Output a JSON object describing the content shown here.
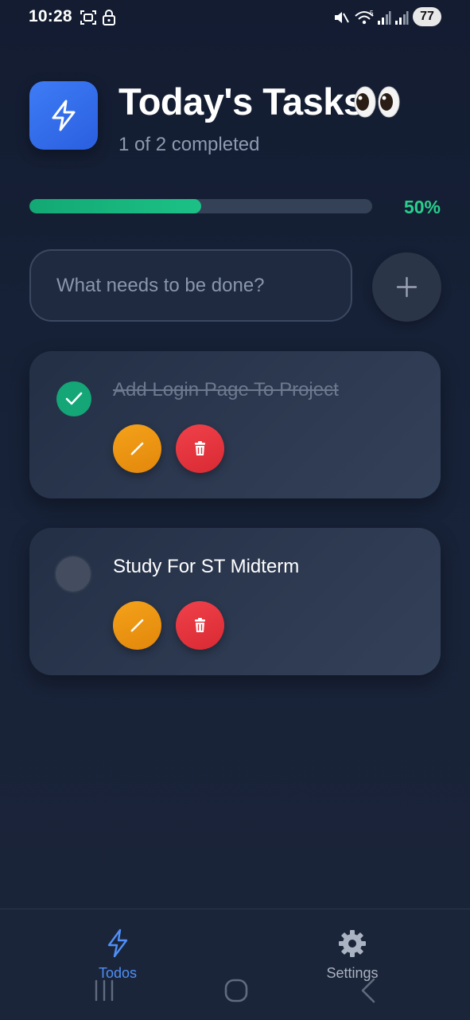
{
  "status_bar": {
    "time": "10:28",
    "battery": "77",
    "icons": [
      "screenshot-icon",
      "lock-icon",
      "mute-icon",
      "wifi-icon",
      "signal-icon",
      "signal-icon"
    ]
  },
  "header": {
    "logo_icon": "lightning-icon",
    "title": "Today's Tasks",
    "title_emoji": "eyes-emoji",
    "subtitle": "1 of 2 completed"
  },
  "progress": {
    "percent": 50,
    "label": "50%",
    "fill_color": "#1cc186"
  },
  "new_task": {
    "placeholder": "What needs to be done?",
    "value": "",
    "add_icon": "plus-icon"
  },
  "tasks": [
    {
      "text": "Add Login Page To Project",
      "completed": true,
      "edit_icon": "pencil-icon",
      "delete_icon": "trash-icon"
    },
    {
      "text": "Study For ST Midterm",
      "completed": false,
      "edit_icon": "pencil-icon",
      "delete_icon": "trash-icon"
    }
  ],
  "nav": {
    "items": [
      {
        "label": "Todos",
        "icon": "lightning-icon",
        "active": true
      },
      {
        "label": "Settings",
        "icon": "gear-icon",
        "active": false
      }
    ]
  },
  "system_nav": [
    "recents-icon",
    "home-icon",
    "back-icon"
  ],
  "colors": {
    "accent": "#4f8ff7",
    "success": "#14a676",
    "edit": "#f4a21a",
    "delete": "#e2343d",
    "background": "#172238"
  }
}
